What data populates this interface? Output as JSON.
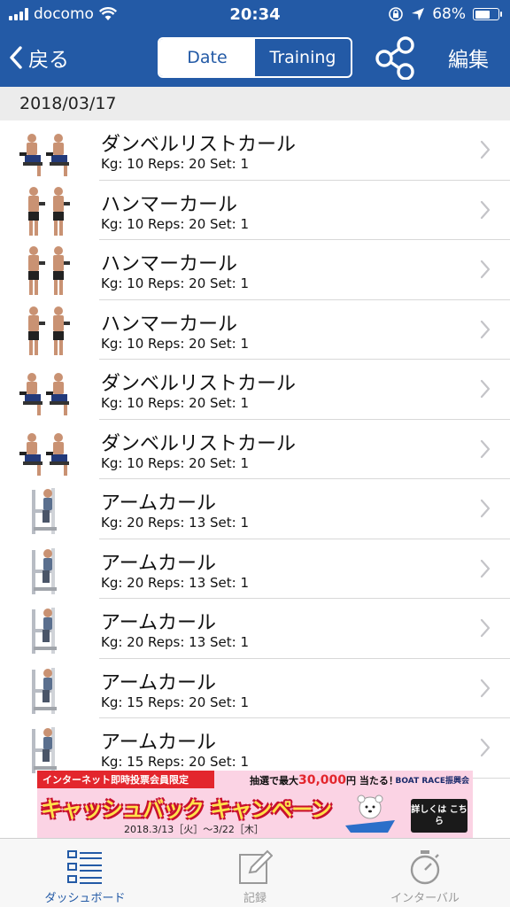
{
  "status_bar": {
    "carrier": "docomo",
    "time": "20:34",
    "battery_percent": "68%",
    "battery_level": 0.68
  },
  "nav": {
    "back_label": "戻る",
    "segments": [
      "Date",
      "Training"
    ],
    "active_segment": "Date",
    "edit_label": "編集"
  },
  "section": {
    "date": "2018/03/17"
  },
  "entries": [
    {
      "name": "ダンベルリストカール",
      "detail": "Kg: 10 Reps: 20 Set: 1",
      "thumb": "wrist-curl-figures"
    },
    {
      "name": "ハンマーカール",
      "detail": "Kg: 10 Reps: 20 Set: 1",
      "thumb": "hammer-curl-figures"
    },
    {
      "name": "ハンマーカール",
      "detail": "Kg: 10 Reps: 20 Set: 1",
      "thumb": "hammer-curl-figures"
    },
    {
      "name": "ハンマーカール",
      "detail": "Kg: 10 Reps: 20 Set: 1",
      "thumb": "hammer-curl-figures"
    },
    {
      "name": "ダンベルリストカール",
      "detail": "Kg: 10 Reps: 20 Set: 1",
      "thumb": "wrist-curl-figures"
    },
    {
      "name": "ダンベルリストカール",
      "detail": "Kg: 10 Reps: 20 Set: 1",
      "thumb": "wrist-curl-figures"
    },
    {
      "name": "アームカール",
      "detail": "Kg: 20 Reps: 13 Set: 1",
      "thumb": "arm-curl-machine"
    },
    {
      "name": "アームカール",
      "detail": "Kg: 20 Reps: 13 Set: 1",
      "thumb": "arm-curl-machine"
    },
    {
      "name": "アームカール",
      "detail": "Kg: 20 Reps: 13 Set: 1",
      "thumb": "arm-curl-machine"
    },
    {
      "name": "アームカール",
      "detail": "Kg: 15 Reps: 20 Set: 1",
      "thumb": "arm-curl-machine"
    },
    {
      "name": "アームカール",
      "detail": "Kg: 15 Reps: 20 Set: 1",
      "thumb": "arm-curl-machine"
    }
  ],
  "ad": {
    "strip": "インターネット即時投票会員限定",
    "prize_prefix": "抽選で最大",
    "prize_amount": "30,000",
    "prize_suffix": "円 当たる！",
    "brand": "BOAT RACE振興会",
    "headline": "キャッシュバック キャンペーン",
    "dates": "2018.3/13［火］〜3/22［木］",
    "cta": "詳しくは こちら"
  },
  "tabbar": {
    "tabs": [
      {
        "label": "ダッシュボード",
        "icon": "dashboard-list-icon"
      },
      {
        "label": "記録",
        "icon": "edit-note-icon"
      },
      {
        "label": "インターバル",
        "icon": "stopwatch-icon"
      }
    ],
    "active_index": 0
  },
  "colors": {
    "nav_blue": "#235aa6",
    "section_gray": "#ececec",
    "inactive_tab": "#999999"
  }
}
